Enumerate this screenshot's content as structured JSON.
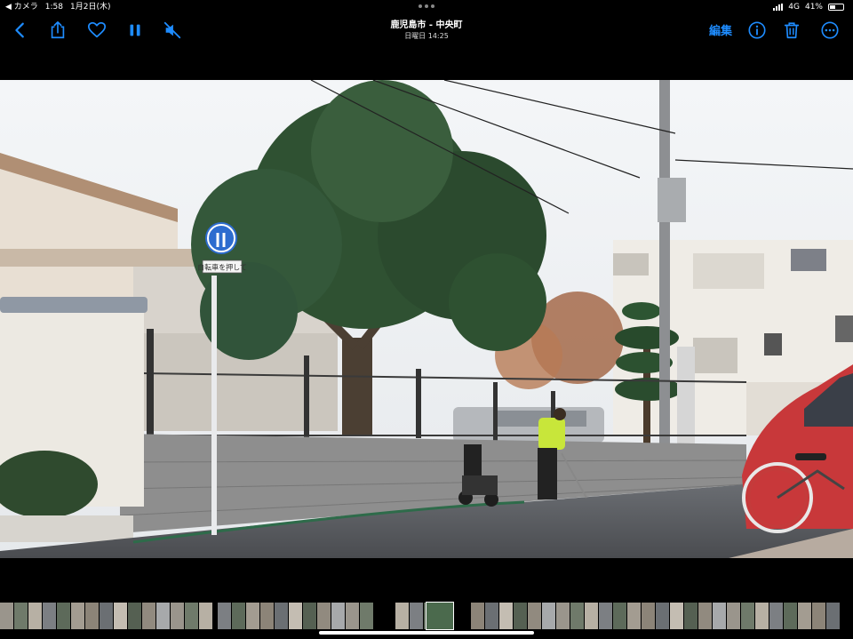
{
  "status": {
    "back_app": "◀ カメラ",
    "time": "1:58",
    "date": "1月2日(木)",
    "network": "4G",
    "battery": "41%",
    "battery_level": 0.41
  },
  "toolbar": {
    "title": "鹿児島市 - 中央町",
    "subtitle": "日曜日 14:25",
    "edit_label": "編集"
  },
  "photo": {
    "sign_text": "自転車を押して"
  },
  "colors": {
    "accent": "#1e8cff",
    "bar_bg": "#000000"
  },
  "icons": [
    "back-chevron-icon",
    "share-icon",
    "heart-icon",
    "pause-icon",
    "mute-icon",
    "info-icon",
    "trash-icon",
    "more-icon"
  ]
}
